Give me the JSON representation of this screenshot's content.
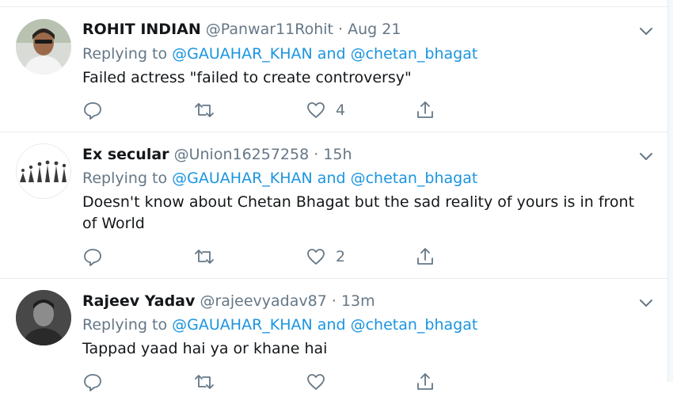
{
  "replying_label": "Replying to",
  "and_label": "and",
  "tweets": [
    {
      "name": "ROHIT INDIAN",
      "handle": "@Panwar11Rohit",
      "separator": "·",
      "time": "Aug 21",
      "mention1": "@GAUAHAR_KHAN",
      "mention2": "@chetan_bhagat",
      "text": "Failed actress \"failed to create controversy\"",
      "like_count": "4"
    },
    {
      "name": "Ex secular",
      "handle": "@Union16257258",
      "separator": "·",
      "time": "15h",
      "mention1": "@GAUAHAR_KHAN",
      "mention2": "@chetan_bhagat",
      "text": "Doesn't know about Chetan Bhagat but the sad reality of yours is in front of World",
      "like_count": "2"
    },
    {
      "name": "Rajeev Yadav",
      "handle": "@rajeevyadav87",
      "separator": "·",
      "time": "13m",
      "mention1": "@GAUAHAR_KHAN",
      "mention2": "@chetan_bhagat",
      "text": "Tappad yaad hai ya or khane hai",
      "like_count": ""
    }
  ],
  "icons": {
    "reply": "reply-icon",
    "retweet": "retweet-icon",
    "like": "heart-icon",
    "share": "share-icon",
    "caret": "chevron-down-icon"
  },
  "colors": {
    "link": "#1b95e0",
    "secondary": "#657786",
    "text": "#14171a",
    "divider": "#e6ecf0"
  }
}
